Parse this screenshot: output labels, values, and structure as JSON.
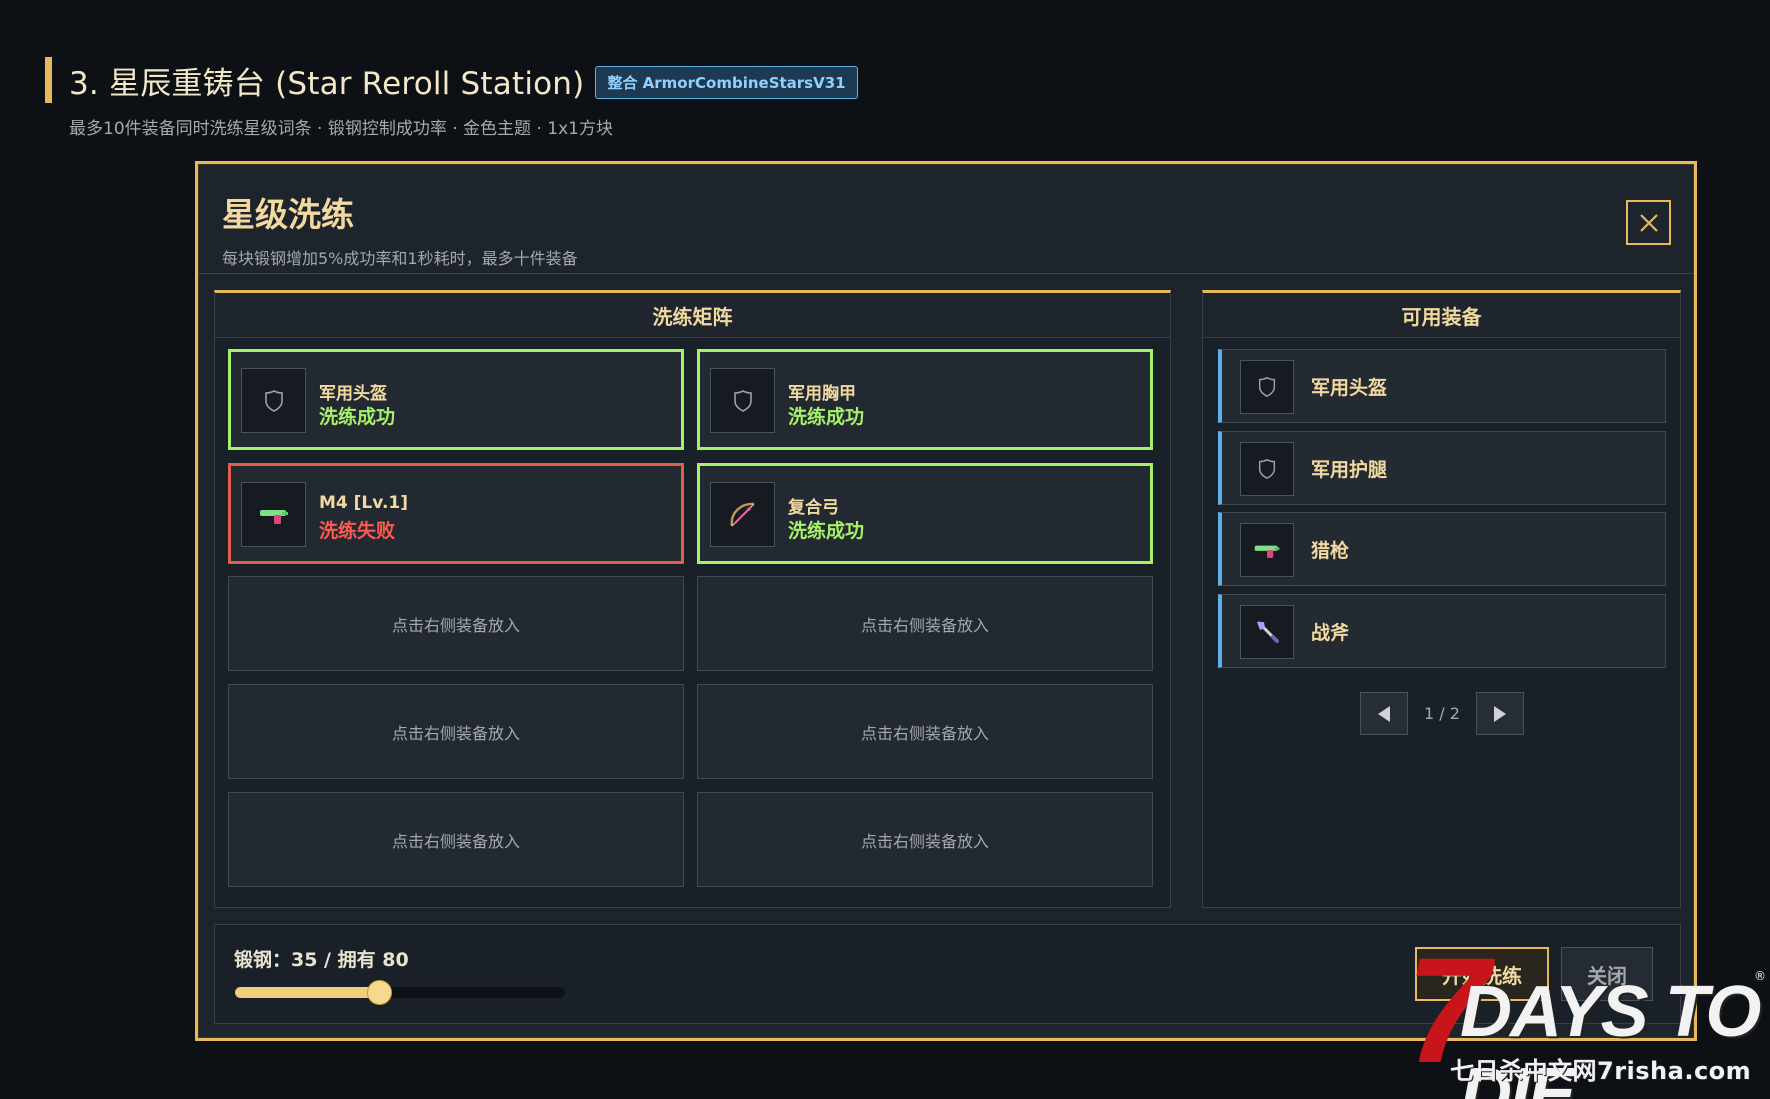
{
  "page": {
    "heading": "3. 星辰重铸台 (Star Reroll Station)",
    "badge": "整合 ArmorCombineStarsV31",
    "subheading": "最多10件装备同时洗练星级词条 · 锻钢控制成功率 · 金色主题 · 1x1方块"
  },
  "dialog": {
    "title": "星级洗练",
    "description": "每块锻钢增加5%成功率和1秒耗时，最多十件装备",
    "close_icon": "close-icon"
  },
  "matrix": {
    "title": "洗练矩阵",
    "slots": [
      {
        "name": "军用头盔",
        "status": "洗练成功",
        "result": "success",
        "icon": "shield-icon"
      },
      {
        "name": "军用胸甲",
        "status": "洗练成功",
        "result": "success",
        "icon": "shield-icon"
      },
      {
        "name": "M4 [Lv.1]",
        "status": "洗练失败",
        "result": "fail",
        "icon": "gun-icon"
      },
      {
        "name": "复合弓",
        "status": "洗练成功",
        "result": "success",
        "icon": "bow-icon"
      }
    ],
    "empty_label": "点击右侧装备放入"
  },
  "equipment": {
    "title": "可用装备",
    "items": [
      {
        "name": "军用头盔",
        "icon": "shield-icon"
      },
      {
        "name": "军用护腿",
        "icon": "shield-icon"
      },
      {
        "name": "猎枪",
        "icon": "gun-icon"
      },
      {
        "name": "战斧",
        "icon": "axe-icon"
      }
    ],
    "pager": {
      "text": "1 / 2"
    }
  },
  "controls": {
    "steel_label": "锻钢：35 / 拥有 80",
    "steel_value": 35,
    "steel_max": 80,
    "start_label": "开始洗练",
    "close_label": "关闭"
  },
  "watermark": {
    "seven": "7",
    "days": "DAYS TO DIE",
    "registered": "®",
    "site": "七日杀中文网7risha.com"
  },
  "colors": {
    "accent_gold": "#e6b95c",
    "success_green": "#a6f168",
    "fail_red": "#e35d4f",
    "info_blue": "#5fb0e6"
  }
}
